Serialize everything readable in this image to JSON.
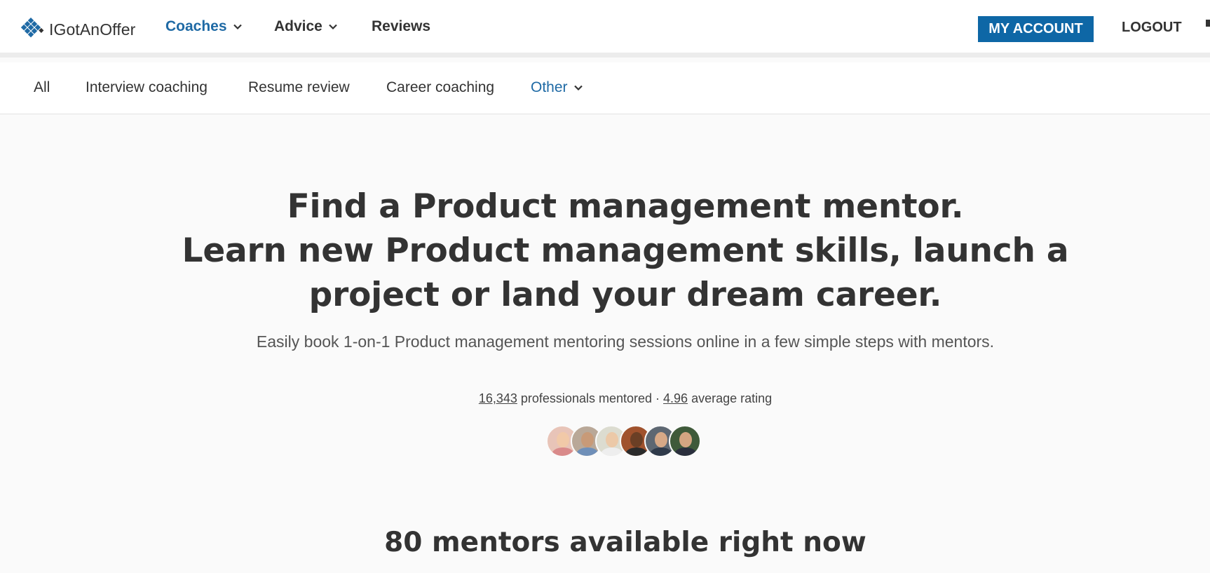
{
  "header": {
    "logo_text": "IGotAnOffer",
    "brand_color": "#1f6aa5",
    "nav": [
      {
        "label": "Coaches",
        "has_dropdown": true,
        "active": true
      },
      {
        "label": "Advice",
        "has_dropdown": true,
        "active": false
      },
      {
        "label": "Reviews",
        "has_dropdown": false,
        "active": false
      }
    ],
    "account_button": "MY ACCOUNT",
    "logout": "LOGOUT"
  },
  "subnav": {
    "items": [
      "All",
      "Interview coaching",
      "Resume review",
      "Career coaching"
    ],
    "other_label": "Other"
  },
  "hero": {
    "title_line1": "Find a Product management mentor.",
    "title_line2": "Learn new Product management skills, launch a",
    "title_line3": "project or land your dream career.",
    "subtitle": "Easily book 1-on-1 Product management mentoring sessions online in a few simple steps with mentors.",
    "stats": {
      "mentored_count": "16,343",
      "mentored_label": "professionals mentored ·",
      "rating": "4.96",
      "rating_label": "average rating"
    },
    "avatar_count": 6
  },
  "mentors_heading": "80 mentors available right now"
}
